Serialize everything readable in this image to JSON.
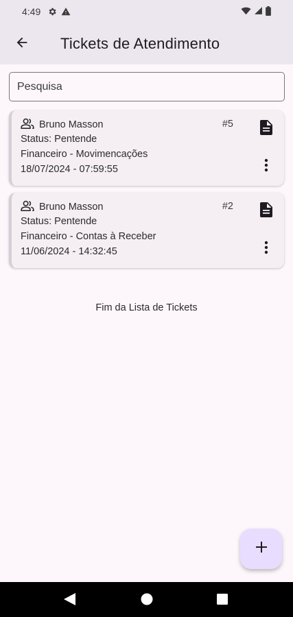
{
  "status_bar": {
    "time": "4:49",
    "icons": [
      "settings-icon",
      "warning-icon",
      "wifi-icon",
      "signal-icon",
      "battery-icon"
    ]
  },
  "app_bar": {
    "title": "Tickets de Atendimento",
    "back_icon": "arrow-back-icon"
  },
  "search": {
    "placeholder": "Pesquisa"
  },
  "tickets": [
    {
      "name": "Bruno Masson",
      "number": "#5",
      "status": "Status: Pentende",
      "department": "Financeiro - Movimencações",
      "datetime": "18/07/2024 - 07:59:55"
    },
    {
      "name": "Bruno Masson",
      "number": "#2",
      "status": "Status: Pentende",
      "department": "Financeiro - Contas à Receber",
      "datetime": "11/06/2024 - 14:32:45"
    }
  ],
  "end_of_list": "Fim da Lista de Tickets",
  "fab": {
    "icon": "add-icon",
    "color": "#e9ddff"
  },
  "colors": {
    "app_bar": "#ece6ef",
    "background": "#fdf7fc",
    "card": "#f5eff4"
  }
}
